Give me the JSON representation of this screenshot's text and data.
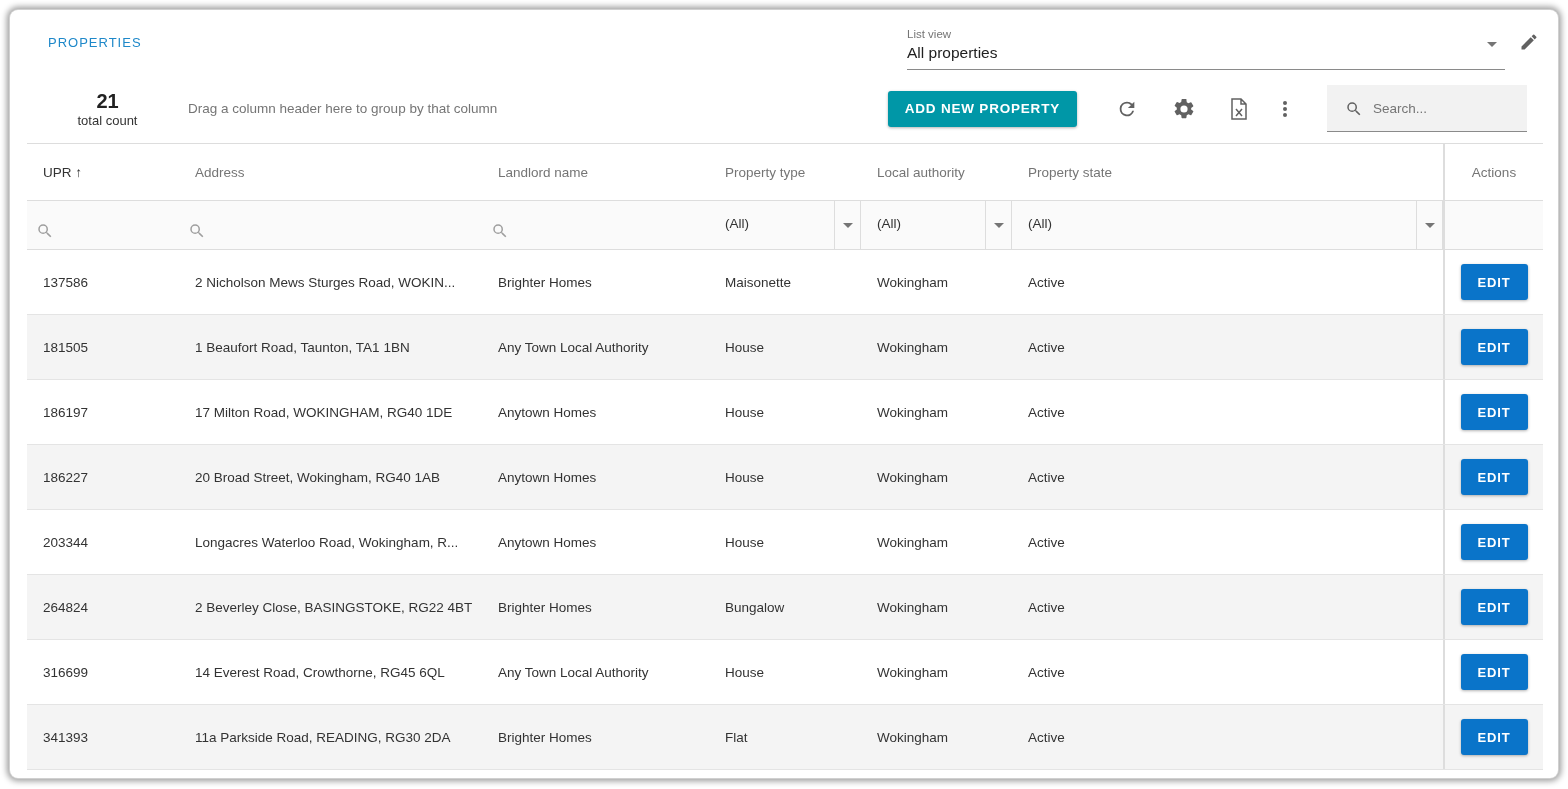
{
  "page_title": "PROPERTIES",
  "list_view": {
    "label": "List view",
    "value": "All properties"
  },
  "total": {
    "count": "21",
    "label": "total count"
  },
  "group_hint": "Drag a column header here to group by that column",
  "add_button": "ADD NEW PROPERTY",
  "search": {
    "placeholder": "Search..."
  },
  "columns": [
    {
      "label": "UPR",
      "sort_mark": "↑",
      "filter": {
        "kind": "search"
      }
    },
    {
      "label": "Address",
      "filter": {
        "kind": "search"
      }
    },
    {
      "label": "Landlord name",
      "filter": {
        "kind": "search"
      }
    },
    {
      "label": "Property type",
      "filter": {
        "kind": "select",
        "value": "(All)"
      }
    },
    {
      "label": "Local authority",
      "filter": {
        "kind": "select",
        "value": "(All)"
      }
    },
    {
      "label": "Property state",
      "filter": {
        "kind": "select",
        "value": "(All)"
      }
    },
    {
      "label": "Actions"
    }
  ],
  "rows": [
    {
      "cells": [
        "137586",
        "2 Nicholson Mews Sturges Road, WOKIN...",
        "Brighter Homes",
        "Maisonette",
        "Wokingham",
        "Active"
      ],
      "action": "EDIT"
    },
    {
      "cells": [
        "181505",
        "1 Beaufort Road, Taunton, TA1 1BN",
        "Any Town Local Authority",
        "House",
        "Wokingham",
        "Active"
      ],
      "action": "EDIT"
    },
    {
      "cells": [
        "186197",
        "17 Milton Road, WOKINGHAM, RG40 1DE",
        "Anytown Homes",
        "House",
        "Wokingham",
        "Active"
      ],
      "action": "EDIT"
    },
    {
      "cells": [
        "186227",
        "20 Broad Street, Wokingham, RG40 1AB",
        "Anytown Homes",
        "House",
        "Wokingham",
        "Active"
      ],
      "action": "EDIT"
    },
    {
      "cells": [
        "203344",
        "Longacres Waterloo Road, Wokingham, R...",
        "Anytown Homes",
        "House",
        "Wokingham",
        "Active"
      ],
      "action": "EDIT"
    },
    {
      "cells": [
        "264824",
        "2 Beverley Close, BASINGSTOKE, RG22 4BT",
        "Brighter Homes",
        "Bungalow",
        "Wokingham",
        "Active"
      ],
      "action": "EDIT"
    },
    {
      "cells": [
        "316699",
        "14 Everest Road, Crowthorne, RG45 6QL",
        "Any Town Local Authority",
        "House",
        "Wokingham",
        "Active"
      ],
      "action": "EDIT"
    },
    {
      "cells": [
        "341393",
        "11a Parkside Road, READING, RG30 2DA",
        "Brighter Homes",
        "Flat",
        "Wokingham",
        "Active"
      ],
      "action": "EDIT"
    }
  ]
}
